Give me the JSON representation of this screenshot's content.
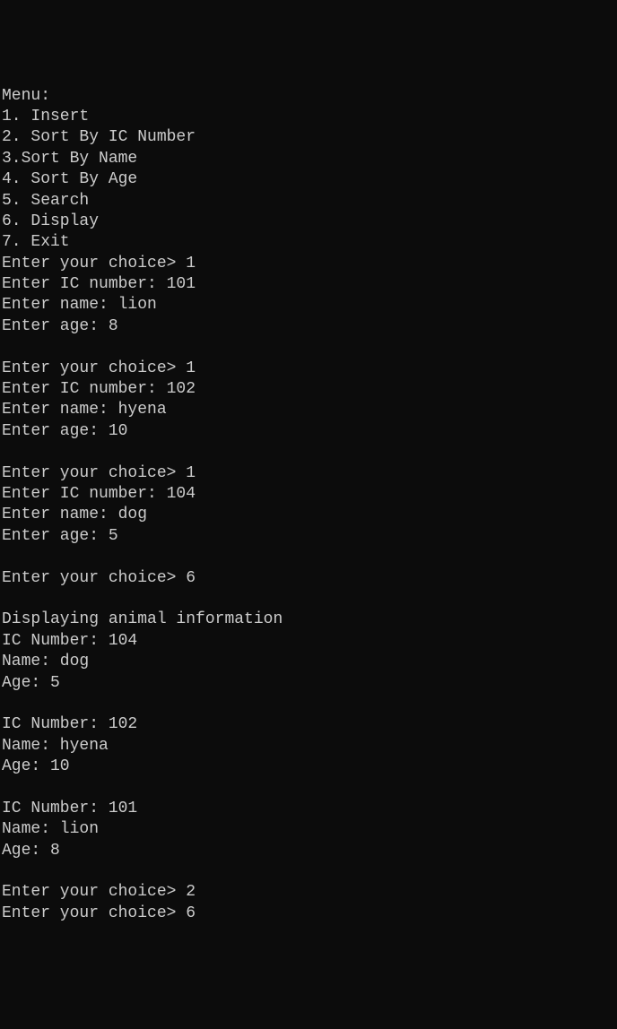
{
  "terminal": {
    "menu_header": "Menu:",
    "menu_item_1": "1. Insert",
    "menu_item_2": "2. Sort By IC Number",
    "menu_item_3": "3.Sort By Name",
    "menu_item_4": "4. Sort By Age",
    "menu_item_5": "5. Search",
    "menu_item_6": "6. Display",
    "menu_item_7": "7. Exit",
    "choice_prompt_1": "Enter your choice> 1",
    "ic_prompt_1": "Enter IC number: 101",
    "name_prompt_1": "Enter name: lion",
    "age_prompt_1": "Enter age: 8",
    "blank_1": "",
    "choice_prompt_2": "Enter your choice> 1",
    "ic_prompt_2": "Enter IC number: 102",
    "name_prompt_2": "Enter name: hyena",
    "age_prompt_2": "Enter age: 10",
    "blank_2": "",
    "choice_prompt_3": "Enter your choice> 1",
    "ic_prompt_3": "Enter IC number: 104",
    "name_prompt_3": "Enter name: dog",
    "age_prompt_3": "Enter age: 5",
    "blank_3": "",
    "choice_prompt_4": "Enter your choice> 6",
    "blank_4": "",
    "display_header": "Displaying animal information",
    "record_1_ic": "IC Number: 104",
    "record_1_name": "Name: dog",
    "record_1_age": "Age: 5",
    "blank_5": "",
    "record_2_ic": "IC Number: 102",
    "record_2_name": "Name: hyena",
    "record_2_age": "Age: 10",
    "blank_6": "",
    "record_3_ic": "IC Number: 101",
    "record_3_name": "Name: lion",
    "record_3_age": "Age: 8",
    "blank_7": "",
    "choice_prompt_5": "Enter your choice> 2",
    "choice_prompt_6": "Enter your choice> 6"
  }
}
